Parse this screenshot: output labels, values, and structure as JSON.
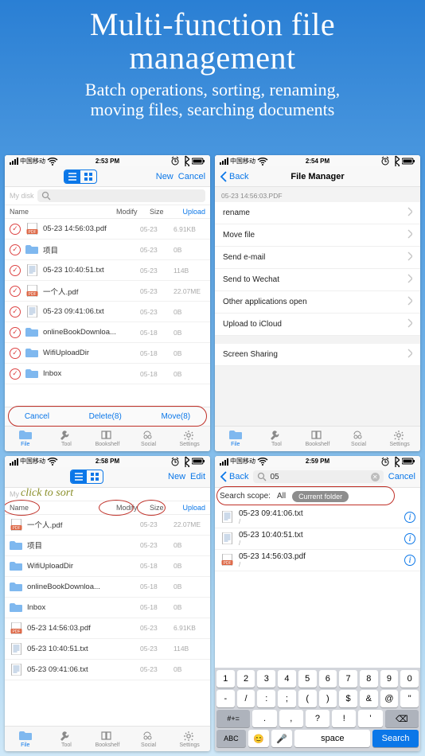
{
  "hero": {
    "title": "Multi-function file\nmanagement",
    "subtitle": "Batch operations, sorting, renaming,\nmoving files, searching documents"
  },
  "carrier": "中国移动",
  "panel1": {
    "time": "2:53 PM",
    "nav_new": "New",
    "nav_cancel": "Cancel",
    "disk": "My disk",
    "th_name": "Name",
    "th_modify": "Modify",
    "th_size": "Size",
    "th_upload": "Upload",
    "rows": [
      {
        "t": "pdf",
        "n": "05-23 14:56:03.pdf",
        "m": "05-23",
        "s": "6.91KB"
      },
      {
        "t": "folder",
        "n": "项目",
        "m": "05-23",
        "s": "0B"
      },
      {
        "t": "txt",
        "n": "05-23 10:40:51.txt",
        "m": "05-23",
        "s": "114B"
      },
      {
        "t": "pdf",
        "n": "一个人.pdf",
        "m": "05-23",
        "s": "22.07ME"
      },
      {
        "t": "txt",
        "n": "05-23 09:41:06.txt",
        "m": "05-23",
        "s": "0B"
      },
      {
        "t": "folder",
        "n": "onlineBookDownloa...",
        "m": "05-18",
        "s": "0B"
      },
      {
        "t": "folder",
        "n": "WifiUploadDir",
        "m": "05-18",
        "s": "0B"
      },
      {
        "t": "folder",
        "n": "Inbox",
        "m": "05-18",
        "s": "0B"
      }
    ],
    "cancel": "Cancel",
    "delete": "Delete(8)",
    "move": "Move(8)"
  },
  "panel2": {
    "time": "2:54 PM",
    "title": "File Manager",
    "back": "Back",
    "group": "05-23 14:56:03.PDF",
    "actions": [
      "rename",
      "Move file",
      "Send e-mail",
      "Send to Wechat",
      "Other applications open",
      "Upload to iCloud"
    ],
    "action_last": "Screen Sharing"
  },
  "panel3": {
    "time": "2:58 PM",
    "nav_new": "New",
    "nav_edit": "Edit",
    "disk": "My",
    "hint": "click to sort",
    "th_name": "Name",
    "th_modify": "Modify",
    "th_size": "Size",
    "th_upload": "Upload",
    "rows": [
      {
        "t": "pdf",
        "n": "一个人.pdf",
        "m": "05-23",
        "s": "22.07ME"
      },
      {
        "t": "folder",
        "n": "项目",
        "m": "05-23",
        "s": "0B"
      },
      {
        "t": "folder",
        "n": "WifiUploadDir",
        "m": "05-18",
        "s": "0B"
      },
      {
        "t": "folder",
        "n": "onlineBookDownloa...",
        "m": "05-18",
        "s": "0B"
      },
      {
        "t": "folder",
        "n": "Inbox",
        "m": "05-18",
        "s": "0B"
      },
      {
        "t": "pdf",
        "n": "05-23 14:56:03.pdf",
        "m": "05-23",
        "s": "6.91KB"
      },
      {
        "t": "txt",
        "n": "05-23 10:40:51.txt",
        "m": "05-23",
        "s": "114B"
      },
      {
        "t": "txt",
        "n": "05-23 09:41:06.txt",
        "m": "05-23",
        "s": "0B"
      }
    ]
  },
  "panel4": {
    "time": "2:59 PM",
    "back": "Back",
    "query": "05",
    "cancel": "Cancel",
    "scope_label": "Search scope:",
    "scope_all": "All",
    "scope_current": "Current folder",
    "results": [
      {
        "n": "05-23 09:41:06.txt",
        "sub": "/"
      },
      {
        "n": "05-23 10:40:51.txt",
        "sub": "/"
      },
      {
        "n": "05-23 14:56:03.pdf",
        "sub": "/"
      }
    ],
    "kbd": {
      "r1": [
        "1",
        "2",
        "3",
        "4",
        "5",
        "6",
        "7",
        "8",
        "9",
        "0"
      ],
      "r2": [
        "-",
        "/",
        ":",
        ";",
        "(",
        ")",
        "$",
        "&",
        "@",
        "\""
      ],
      "r3_shift": "#+=",
      "r3": [
        ".",
        ",",
        "?",
        "!",
        "'"
      ],
      "r3_del": "⌫",
      "r4_abc": "ABC",
      "r4_emoji": "😊",
      "r4_mic": "🎤",
      "r4_space": "space",
      "r4_search": "Search"
    }
  },
  "tabs": [
    "File",
    "Tool",
    "Bookshelf",
    "Social",
    "Settings"
  ]
}
